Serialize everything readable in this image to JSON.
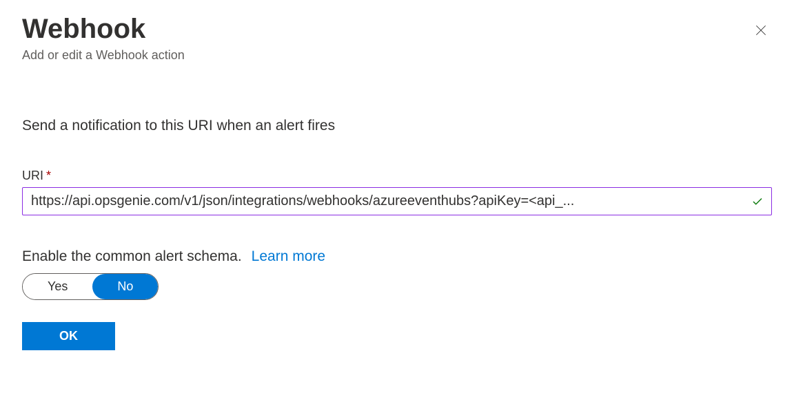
{
  "header": {
    "title": "Webhook",
    "subtitle": "Add or edit a Webhook action"
  },
  "description": "Send a notification to this URI when an alert fires",
  "uri_field": {
    "label": "URI",
    "required_mark": "*",
    "value": "https://api.opsgenie.com/v1/json/integrations/webhooks/azureeventhubs?apiKey=<api_..."
  },
  "schema": {
    "label": "Enable the common alert schema.",
    "learn_more": "Learn more",
    "yes_label": "Yes",
    "no_label": "No",
    "selected": "No"
  },
  "buttons": {
    "ok": "OK"
  }
}
